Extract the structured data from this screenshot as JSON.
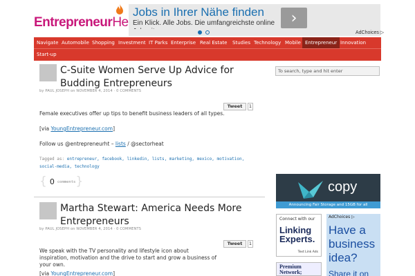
{
  "header": {
    "logo_part1": "Entrepreneur",
    "logo_part2": "Heat"
  },
  "ad": {
    "title": "Jobs in Ihrer Nähe finden",
    "text": "Ein Klick. Alle Jobs. Die umfangreichste online Jobseite.",
    "arrow": "›",
    "adchoices": "AdChoices ▷"
  },
  "nav": {
    "items": [
      "Navigate",
      "Automobile",
      "Shopping",
      "Investment",
      "IT Parks",
      "Enterprise",
      "Real Estate",
      "Studies",
      "Technology",
      "Mobile",
      "Entrepreneur",
      "Innovation",
      "Start-up"
    ],
    "active": "Entrepreneur"
  },
  "posts": [
    {
      "title": "C-Suite Women Serve Up Advice for Budding Entrepreneurs",
      "meta": "by PAUL JOSEPH on NOVEMBER 4, 2014 · 0 COMMENTS",
      "tweet_label": "Tweet",
      "tweet_count": "1",
      "body1": "Female executives offer up tips to benefit business leaders of all types.",
      "via_pre": "[via ",
      "via_link": "YoungEntrepreneur.com",
      "via_post": "]",
      "follow_pre": "Follow us @entrepreneurht – ",
      "follow_link": "lists",
      "follow_post": " / @sectorheat",
      "tags_label": "Tagged as:",
      "tags": "entrepreneur, facebook, linkedin, lists, marketing, mexico, motivation, social-media, technology",
      "comment_count": "0",
      "comment_label": "comments"
    },
    {
      "title": "Martha Stewart: America Needs More Entrepreneurs",
      "meta": "by PAUL JOSEPH on NOVEMBER 4, 2014 · 0 COMMENTS",
      "tweet_label": "Tweet",
      "tweet_count": "1",
      "body1": "We speak with the TV personality and lifestyle icon about inspiration, motivation and the drive to start and grow a business of your own.",
      "via_pre": "[via ",
      "via_link": "YoungEntrepreneur.com",
      "via_post": "]"
    }
  ],
  "sidebar": {
    "search_placeholder": "To search, type and hit enter",
    "copy_word": "copy",
    "copy_foot": "Announcing Fair Storage and 15GB for all",
    "linking_small": "Connect with our",
    "linking_big": "Linking Experts.",
    "linking_brand": "Text Link Ads",
    "premium": "Premium Network;",
    "idea_choices": "AdChoices ▷",
    "idea_text": "Have a business idea?",
    "idea_sub": "Share it on"
  },
  "colors": {
    "nav_bg": "#d8392c",
    "nav_active": "#8a2318",
    "logo": "#c8177a",
    "link": "#1a6fb0"
  }
}
